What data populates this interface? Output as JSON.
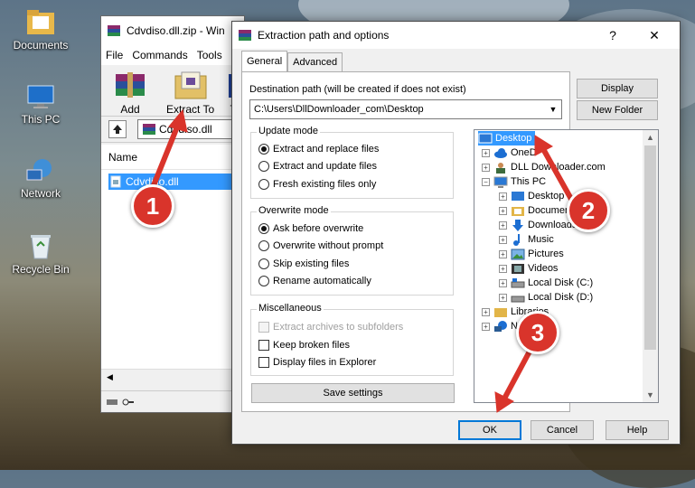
{
  "desktop": {
    "icons": [
      {
        "label": "Documents"
      },
      {
        "label": "This PC"
      },
      {
        "label": "Network"
      },
      {
        "label": "Recycle Bin"
      }
    ]
  },
  "winrar": {
    "title": "Cdvdiso.dll.zip - Win",
    "menu": [
      "File",
      "Commands",
      "Tools"
    ],
    "toolbar": {
      "add": "Add",
      "extract": "Extract To",
      "third": "T"
    },
    "path": "Cdvdiso.dll",
    "column_name": "Name",
    "file": "Cdvdiso.dll"
  },
  "dialog": {
    "title": "Extraction path and options",
    "help_glyph": "?",
    "close_glyph": "✕",
    "tabs": [
      "General",
      "Advanced"
    ],
    "destination_label": "Destination path (will be created if does not exist)",
    "destination_value": "C:\\Users\\DllDownloader_com\\Desktop",
    "buttons": {
      "display": "Display",
      "new_folder": "New Folder",
      "save_settings": "Save settings",
      "ok": "OK",
      "cancel": "Cancel",
      "help": "Help"
    },
    "update_mode": {
      "title": "Update mode",
      "options": [
        "Extract and replace files",
        "Extract and update files",
        "Fresh existing files only"
      ],
      "selected": 0
    },
    "overwrite_mode": {
      "title": "Overwrite mode",
      "options": [
        "Ask before overwrite",
        "Overwrite without prompt",
        "Skip existing files",
        "Rename automatically"
      ],
      "selected": 0
    },
    "miscellaneous": {
      "title": "Miscellaneous",
      "options": [
        "Extract archives to subfolders",
        "Keep broken files",
        "Display files in Explorer"
      ]
    },
    "tree": [
      "Desktop",
      "OneD",
      "DLL Downloader.com",
      "This PC",
      "Desktop",
      "Documen",
      "Downloads",
      "Music",
      "Pictures",
      "Videos",
      "Local Disk (C:)",
      "Local Disk (D:)",
      "Libraries",
      "Ne"
    ]
  },
  "annotations": {
    "step1": "1",
    "step2": "2",
    "step3": "3"
  },
  "colors": {
    "badge": "#d9342b",
    "selection": "#3399ff",
    "accent": "#0078d7"
  }
}
